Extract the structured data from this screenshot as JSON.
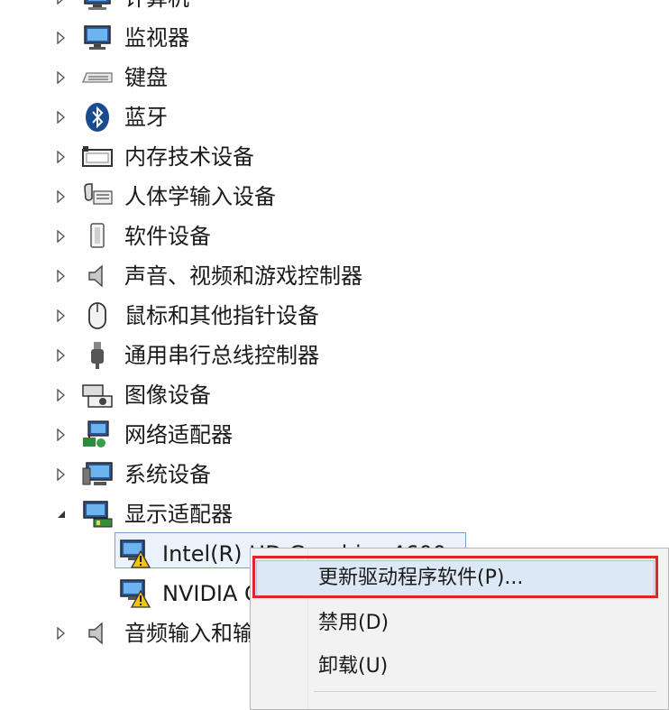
{
  "tree": {
    "items": [
      {
        "label": "计算机",
        "icon": "computer-icon",
        "expanded": false
      },
      {
        "label": "监视器",
        "icon": "monitor-icon",
        "expanded": false
      },
      {
        "label": "键盘",
        "icon": "keyboard-icon",
        "expanded": false
      },
      {
        "label": "蓝牙",
        "icon": "bluetooth-icon",
        "expanded": false
      },
      {
        "label": "内存技术设备",
        "icon": "memory-device-icon",
        "expanded": false
      },
      {
        "label": "人体学输入设备",
        "icon": "hid-icon",
        "expanded": false
      },
      {
        "label": "软件设备",
        "icon": "software-device-icon",
        "expanded": false
      },
      {
        "label": "声音、视频和游戏控制器",
        "icon": "speaker-icon",
        "expanded": false
      },
      {
        "label": "鼠标和其他指针设备",
        "icon": "mouse-icon",
        "expanded": false
      },
      {
        "label": "通用串行总线控制器",
        "icon": "usb-icon",
        "expanded": false
      },
      {
        "label": "图像设备",
        "icon": "camera-icon",
        "expanded": false
      },
      {
        "label": "网络适配器",
        "icon": "network-adapter-icon",
        "expanded": false
      },
      {
        "label": "系统设备",
        "icon": "system-device-icon",
        "expanded": false
      },
      {
        "label": "显示适配器",
        "icon": "display-adapter-icon",
        "expanded": true
      },
      {
        "label": "音频输入和输出",
        "icon": "speaker-icon",
        "expanded": false
      }
    ],
    "display_children": [
      {
        "label": "Intel(R) HD Graphics 4600",
        "icon": "warning-monitor-icon",
        "selected": true
      },
      {
        "label": "NVIDIA GeForce",
        "icon": "warning-monitor-icon",
        "selected": false
      }
    ]
  },
  "context_menu": {
    "items": [
      {
        "label": "更新驱动程序软件(P)...",
        "highlighted": true
      },
      {
        "label": "禁用(D)",
        "highlighted": false
      },
      {
        "label": "卸载(U)",
        "highlighted": false
      }
    ]
  },
  "colors": {
    "highlight_border": "#e0242c",
    "selection_border": "#7da2ce",
    "warning": "#f5c400"
  }
}
